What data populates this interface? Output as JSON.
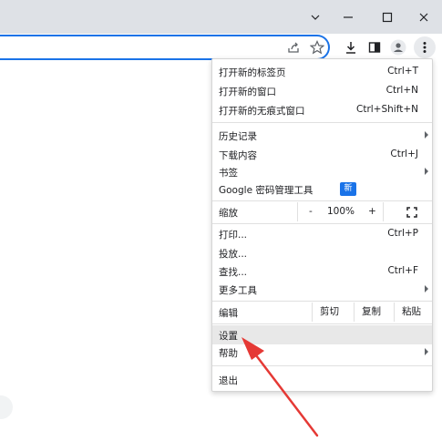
{
  "window": {
    "controls": [
      "chevron-down-icon",
      "minimize-icon",
      "maximize-icon",
      "close-icon"
    ]
  },
  "toolbar": {
    "icons": [
      "share-icon",
      "star-icon",
      "download-icon",
      "side-panel-icon",
      "profile-icon",
      "more-menu-icon"
    ]
  },
  "menu": {
    "new_tab": {
      "label": "打开新的标签页",
      "shortcut": "Ctrl+T"
    },
    "new_window": {
      "label": "打开新的窗口",
      "shortcut": "Ctrl+N"
    },
    "incognito": {
      "label": "打开新的无痕式窗口",
      "shortcut": "Ctrl+Shift+N"
    },
    "history": {
      "label": "历史记录"
    },
    "downloads": {
      "label": "下载内容",
      "shortcut": "Ctrl+J"
    },
    "bookmarks": {
      "label": "书签"
    },
    "password_manager": {
      "label": "Google 密码管理工具",
      "badge": "新"
    },
    "zoom": {
      "label": "缩放",
      "minus": "-",
      "value": "100%",
      "plus": "+",
      "fullscreen_icon": "fullscreen-icon"
    },
    "print": {
      "label": "打印...",
      "shortcut": "Ctrl+P"
    },
    "cast": {
      "label": "投放..."
    },
    "find": {
      "label": "查找...",
      "shortcut": "Ctrl+F"
    },
    "more_tools": {
      "label": "更多工具"
    },
    "edit": {
      "label": "编辑",
      "cut": "剪切",
      "copy": "复制",
      "paste": "粘贴"
    },
    "settings": {
      "label": "设置"
    },
    "help": {
      "label": "帮助"
    },
    "exit": {
      "label": "退出"
    }
  },
  "colors": {
    "accent": "#1a73e8",
    "highlight_row": "#e8e8e8",
    "annotation_arrow": "#e53935"
  }
}
